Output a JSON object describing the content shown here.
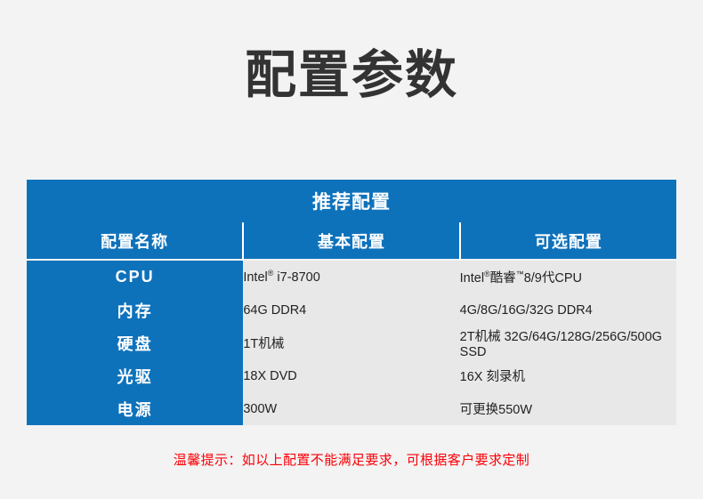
{
  "page": {
    "title": "配置参数",
    "background_color": "#f3f3f3",
    "title_color": "#333333",
    "accent_color": "#0e72bb",
    "cell_color": "#e8e8e8",
    "note_color": "#fb0007"
  },
  "table": {
    "banner": "推荐配置",
    "columns": [
      {
        "key": "name",
        "label": "配置名称"
      },
      {
        "key": "basic",
        "label": "基本配置"
      },
      {
        "key": "optional",
        "label": "可选配置"
      }
    ],
    "rows": [
      {
        "name": "CPU",
        "basic_prefix": "Intel",
        "basic_sup": "®",
        "basic_suffix": " i7-8700",
        "basic_text": "Intel® i7-8700",
        "optional_prefix": "Intel",
        "optional_sup": "®",
        "optional_mid": "酷睿",
        "optional_sup2": "™",
        "optional_suffix": "8/9代CPU",
        "optional_text": "Intel®酷睿™8/9代CPU"
      },
      {
        "name": "内存",
        "basic_text": "64G DDR4",
        "optional_text": "4G/8G/16G/32G DDR4"
      },
      {
        "name": "硬盘",
        "basic_text": "1T机械",
        "optional_text": "2T机械 32G/64G/128G/256G/500G SSD"
      },
      {
        "name": "光驱",
        "basic_text": "18X DVD",
        "optional_text": "16X 刻录机"
      },
      {
        "name": "电源",
        "basic_text": "300W",
        "optional_text": "可更换550W"
      }
    ]
  },
  "footer": {
    "note": "温馨提示：如以上配置不能满足要求，可根据客户要求定制"
  }
}
